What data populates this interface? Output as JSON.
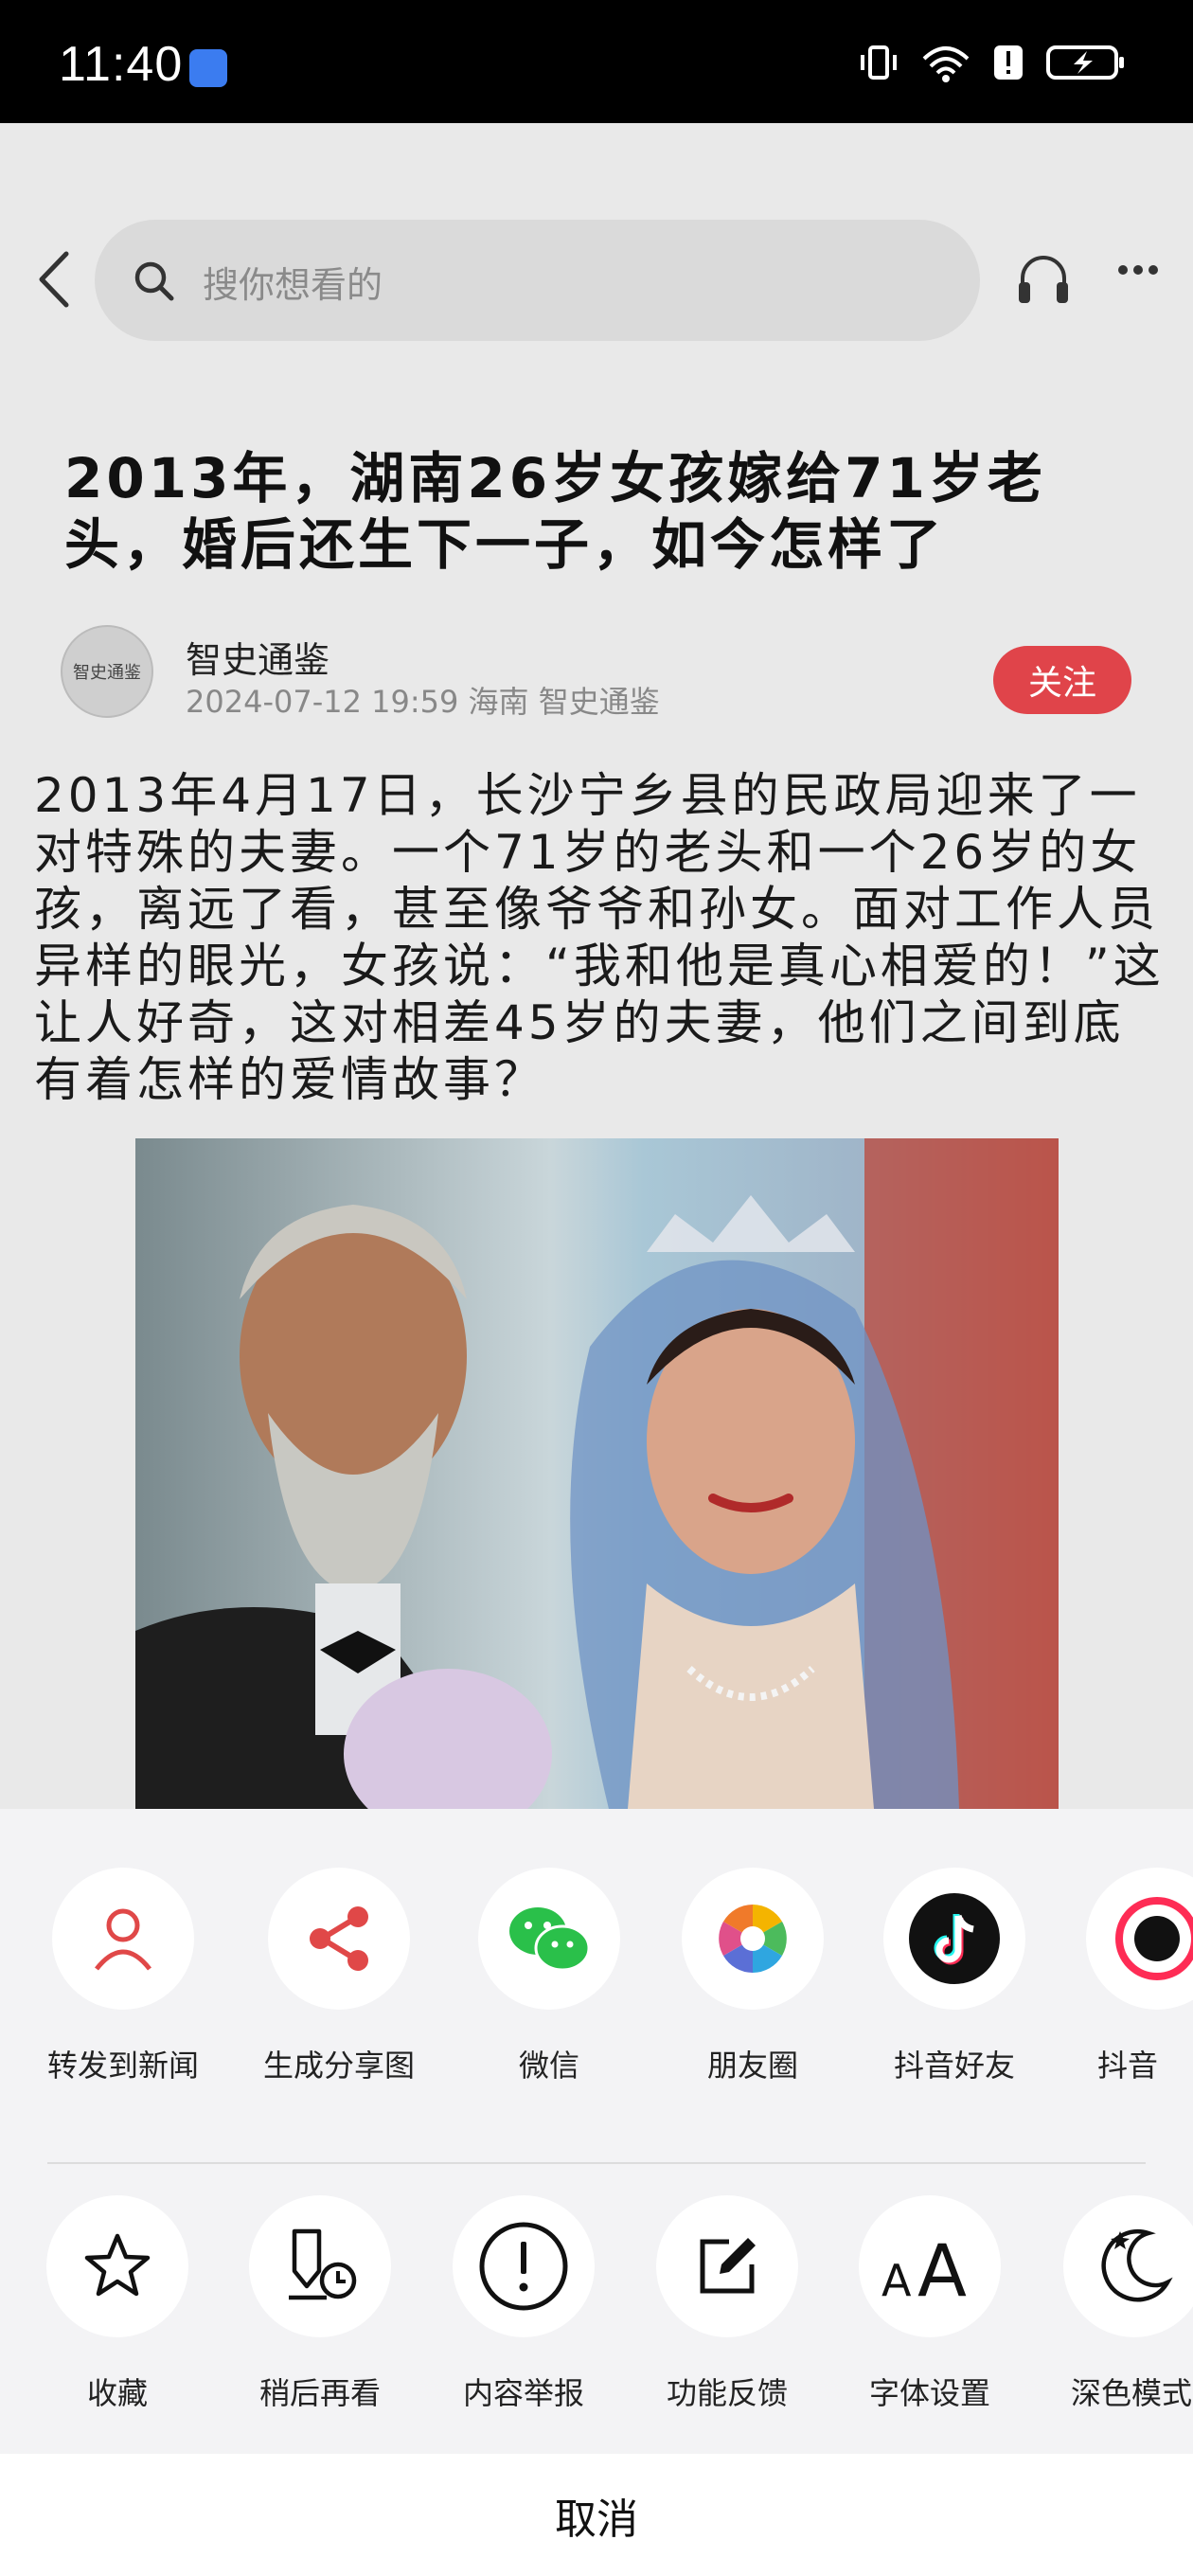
{
  "status": {
    "time": "11:40"
  },
  "search": {
    "placeholder": "搜你想看的"
  },
  "article": {
    "title": "2013年，湖南26岁女孩嫁给71岁老头，婚后还生下一子，如今怎样了",
    "author": "智史通鉴",
    "meta": "2024-07-12 19:59 海南 智史通鉴",
    "follow": "关注",
    "avatar_text": "智史通鉴",
    "body": "2013年4月17日，长沙宁乡县的民政局迎来了一对特殊的夫妻。一个71岁的老头和一个26岁的女孩，离远了看，甚至像爷爷和孙女。面对工作人员异样的眼光，女孩说：“我和他是真心相爱的！”这让人好奇，这对相差45岁的夫妻，他们之间到底有着怎样的爱情故事？"
  },
  "share_row": [
    {
      "label": "转发到新闻",
      "icon": "person-icon"
    },
    {
      "label": "生成分享图",
      "icon": "share-icon"
    },
    {
      "label": "微信",
      "icon": "wechat-icon"
    },
    {
      "label": "朋友圈",
      "icon": "moments-icon"
    },
    {
      "label": "抖音好友",
      "icon": "tiktok-icon"
    },
    {
      "label": "抖音",
      "icon": "tiktok-icon"
    }
  ],
  "action_row": [
    {
      "label": "收藏",
      "icon": "star-icon"
    },
    {
      "label": "稍后再看",
      "icon": "read-later-icon"
    },
    {
      "label": "内容举报",
      "icon": "report-icon"
    },
    {
      "label": "功能反馈",
      "icon": "feedback-icon"
    },
    {
      "label": "字体设置",
      "icon": "font-icon"
    },
    {
      "label": "深色模式",
      "icon": "dark-mode-icon"
    }
  ],
  "cancel": "取消",
  "colors": {
    "follow": "#e0444a",
    "share_red": "#e04848",
    "wechat": "#2ac04a"
  }
}
